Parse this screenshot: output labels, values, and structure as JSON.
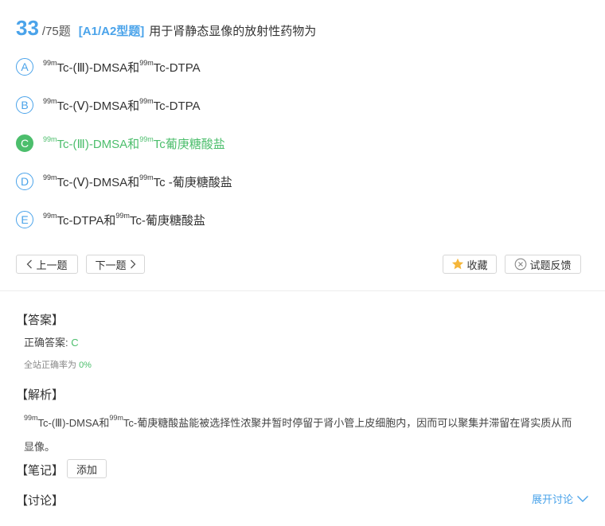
{
  "question": {
    "number": "33",
    "total": "/75题",
    "type": "[A1/A2型题]",
    "text": "用于肾静态显像的放射性药物为"
  },
  "options": [
    {
      "letter": "A",
      "p1": "Tc-(Ⅲ)-DMSA和",
      "p2": "Tc-DTPA"
    },
    {
      "letter": "B",
      "p1": "Tc-(Ⅴ)-DMSA和",
      "p2": "Tc-DTPA"
    },
    {
      "letter": "C",
      "p1": "Tc-(Ⅲ)-DMSA和",
      "p2": "Tc葡庚糖酸盐"
    },
    {
      "letter": "D",
      "p1": "Tc-(Ⅴ)-DMSA和",
      "p2": "Tc -葡庚糖酸盐"
    },
    {
      "letter": "E",
      "p1": "Tc-DTPA和",
      "p2": "Tc-葡庚糖酸盐"
    }
  ],
  "isotope": "99m",
  "correct_option": "C",
  "buttons": {
    "prev": "上一题",
    "next": "下一题",
    "favorite": "收藏",
    "feedback": "试题反馈"
  },
  "answer_section": {
    "title": "【答案】",
    "correct_label": "正确答案: ",
    "correct_value": "C",
    "rate_label": "全站正确率为 ",
    "rate_value": "0%"
  },
  "analysis_section": {
    "title": "【解析】",
    "p1": "Tc-(Ⅲ)-DMSA和",
    "p2": "Tc-葡庚糖酸盐能被选择性浓聚并暂时停留于肾小管上皮细胞内，因而可以聚集并滞留在肾实质从而显像。"
  },
  "notes_section": {
    "title": "【笔记】",
    "add_label": "添加"
  },
  "discussion_section": {
    "title": "【讨论】",
    "expand_label": "展开讨论"
  },
  "colors": {
    "accent": "#4aa3ea",
    "correct": "#4cbe6c",
    "star": "#f5b63a"
  }
}
